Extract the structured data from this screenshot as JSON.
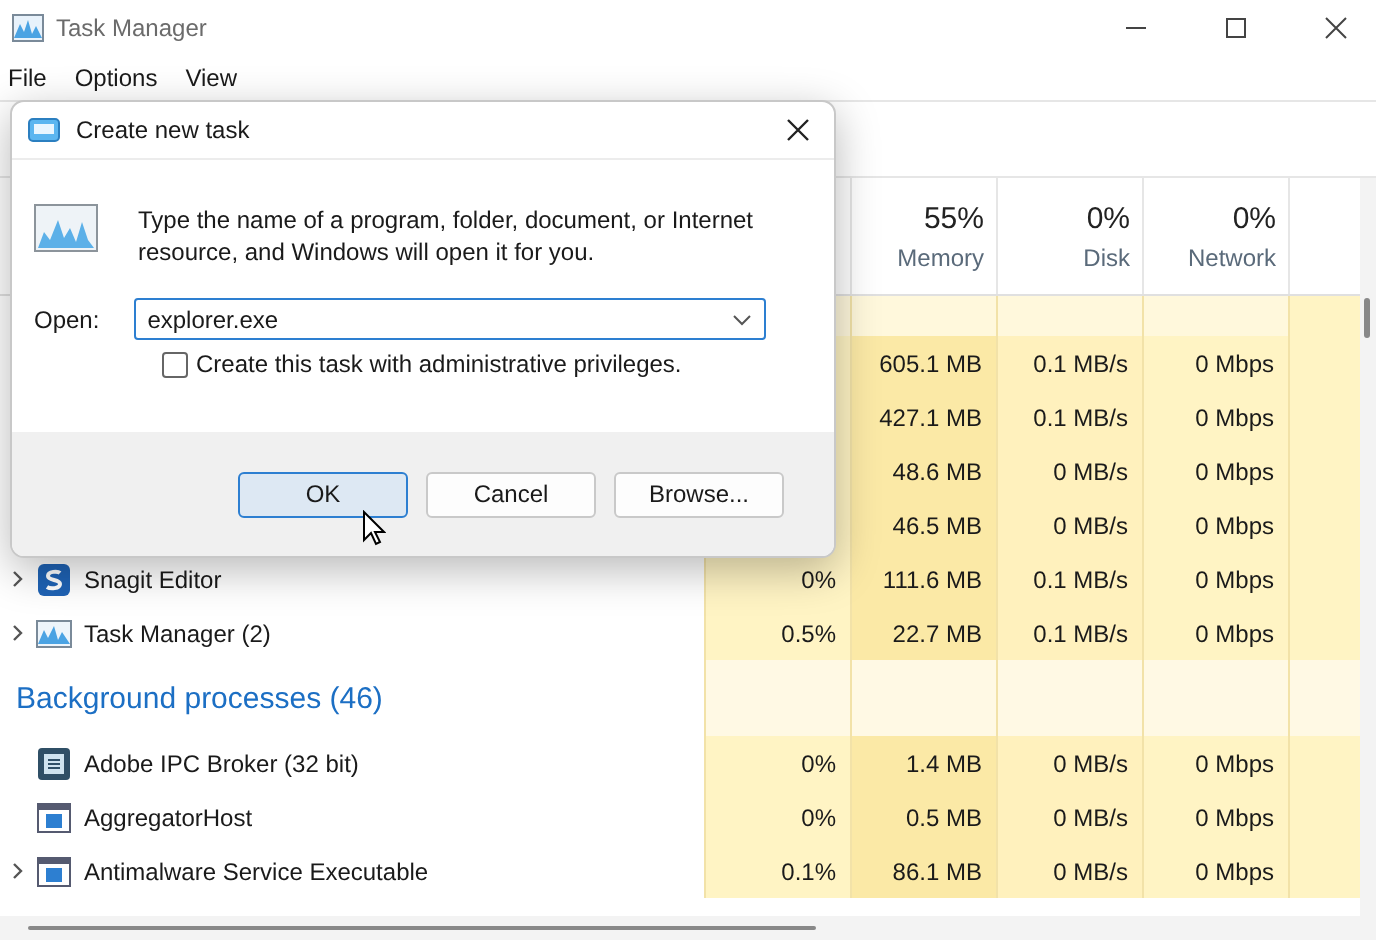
{
  "window": {
    "title": "Task Manager"
  },
  "menu": [
    "File",
    "Options",
    "View"
  ],
  "columns": [
    {},
    {
      "percent": "55%",
      "label": "Memory"
    },
    {
      "percent": "0%",
      "label": "Disk"
    },
    {
      "percent": "0%",
      "label": "Network"
    }
  ],
  "rows": [
    {
      "kind": "blank"
    },
    {
      "kind": "process",
      "memory": "605.1 MB",
      "disk": "0.1 MB/s",
      "network": "0 Mbps"
    },
    {
      "kind": "process",
      "memory": "427.1 MB",
      "disk": "0.1 MB/s",
      "network": "0 Mbps"
    },
    {
      "kind": "process",
      "memory": "48.6 MB",
      "disk": "0 MB/s",
      "network": "0 Mbps"
    },
    {
      "kind": "process",
      "memory": "46.5 MB",
      "disk": "0 MB/s",
      "network": "0 Mbps"
    },
    {
      "kind": "process",
      "expandable": true,
      "name": "Snagit Editor",
      "cpu": "0%",
      "memory": "111.6 MB",
      "disk": "0.1 MB/s",
      "network": "0 Mbps"
    },
    {
      "kind": "process",
      "expandable": true,
      "name": "Task Manager (2)",
      "cpu": "0.5%",
      "memory": "22.7 MB",
      "disk": "0.1 MB/s",
      "network": "0 Mbps"
    },
    {
      "kind": "group",
      "name": "Background processes (46)"
    },
    {
      "kind": "process",
      "expandable": false,
      "name": "Adobe IPC Broker (32 bit)",
      "cpu": "0%",
      "memory": "1.4 MB",
      "disk": "0 MB/s",
      "network": "0 Mbps"
    },
    {
      "kind": "process",
      "expandable": false,
      "name": "AggregatorHost",
      "cpu": "0%",
      "memory": "0.5 MB",
      "disk": "0 MB/s",
      "network": "0 Mbps"
    },
    {
      "kind": "process",
      "expandable": true,
      "name": "Antimalware Service Executable",
      "cpu": "0.1%",
      "memory": "86.1 MB",
      "disk": "0 MB/s",
      "network": "0 Mbps"
    }
  ],
  "dialog": {
    "title": "Create new task",
    "message": "Type the name of a program, folder, document, or Internet resource, and Windows will open it for you.",
    "open_label": "Open:",
    "open_value": "explorer.exe",
    "admin_label": "Create this task with administrative privileges.",
    "admin_checked": false,
    "buttons": [
      {
        "label": "OK",
        "selected": true
      },
      {
        "label": "Cancel",
        "selected": false
      },
      {
        "label": "Browse...",
        "selected": false
      }
    ]
  }
}
